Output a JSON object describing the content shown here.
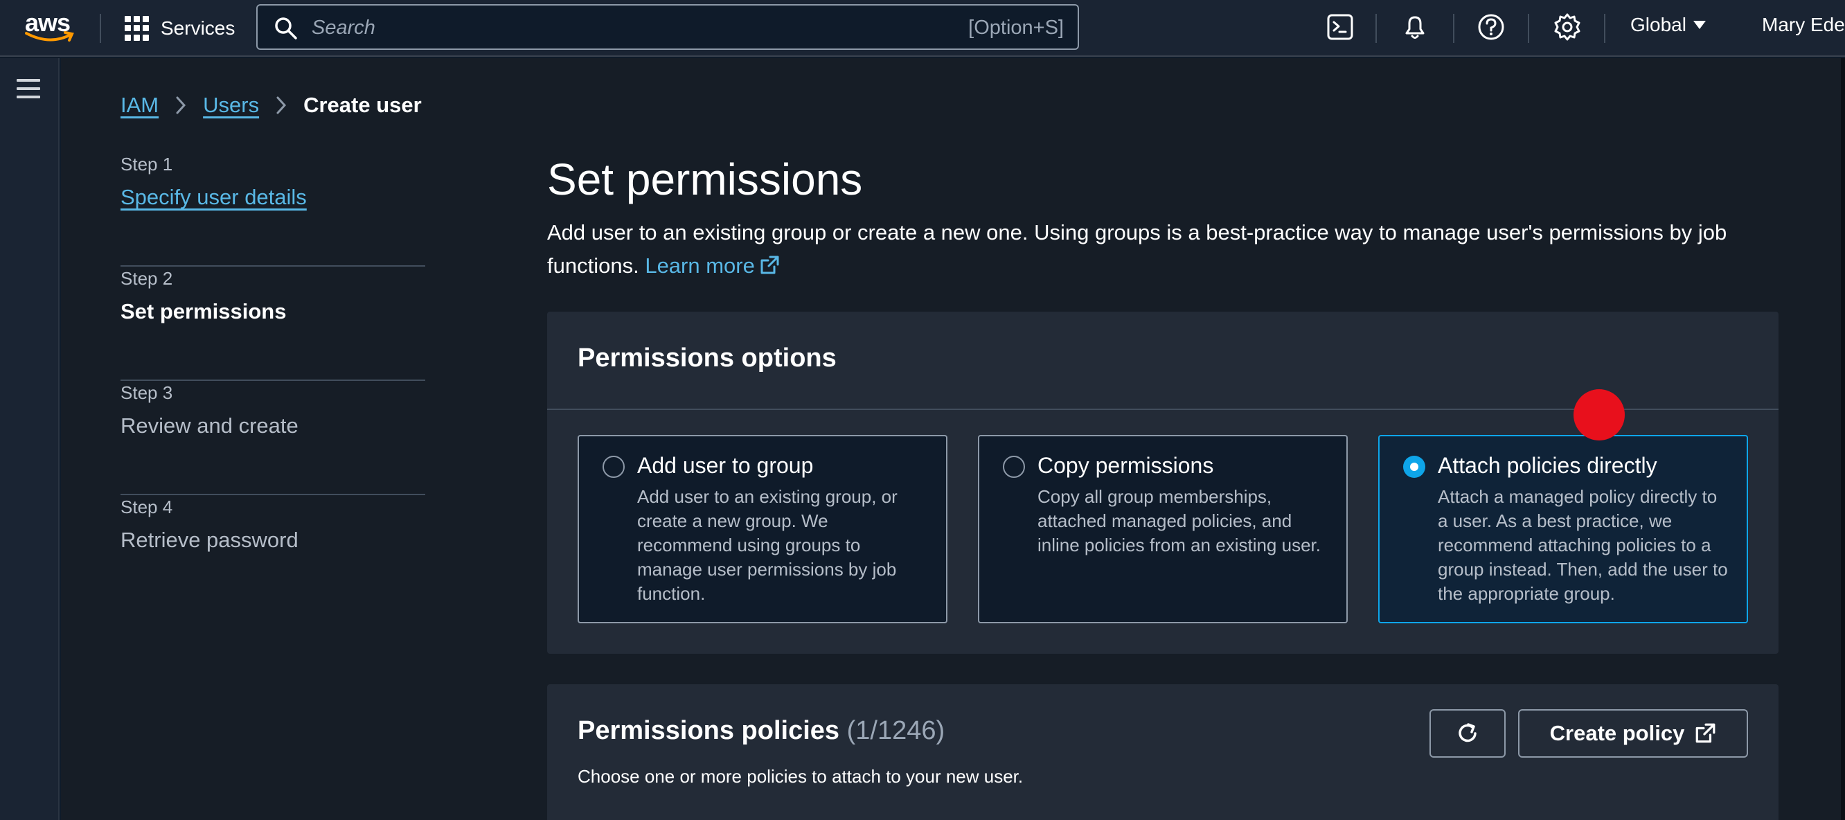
{
  "nav": {
    "logo_text": "aws",
    "services_label": "Services",
    "search_placeholder": "Search",
    "search_shortcut": "[Option+S]",
    "region": "Global",
    "user": "Mary Edeh"
  },
  "breadcrumb": {
    "items": [
      "IAM",
      "Users"
    ],
    "current": "Create user"
  },
  "steps": [
    {
      "num": "Step 1",
      "title": "Specify user details"
    },
    {
      "num": "Step 2",
      "title": "Set permissions"
    },
    {
      "num": "Step 3",
      "title": "Review and create"
    },
    {
      "num": "Step 4",
      "title": "Retrieve password"
    }
  ],
  "header": {
    "title": "Set permissions",
    "description": "Add user to an existing group or create a new one. Using groups is a best-practice way to manage user's permissions by job functions.",
    "learn_more": "Learn more"
  },
  "permissions_options": {
    "title": "Permissions options",
    "options": [
      {
        "title": "Add user to group",
        "description": "Add user to an existing group, or create a new group. We recommend using groups to manage user permissions by job function.",
        "selected": false
      },
      {
        "title": "Copy permissions",
        "description": "Copy all group memberships, attached managed policies, and inline policies from an existing user.",
        "selected": false
      },
      {
        "title": "Attach policies directly",
        "description": "Attach a managed policy directly to a user. As a best practice, we recommend attaching policies to a group instead. Then, add the user to the appropriate group.",
        "selected": true
      }
    ]
  },
  "permissions_policies": {
    "title": "Permissions policies",
    "count": "(1/1246)",
    "description": "Choose one or more policies to attach to your new user.",
    "create_policy_label": "Create policy"
  },
  "colors": {
    "accent": "#0ea5e9",
    "link": "#59b8e6",
    "cursor_marker": "#e8101c"
  }
}
